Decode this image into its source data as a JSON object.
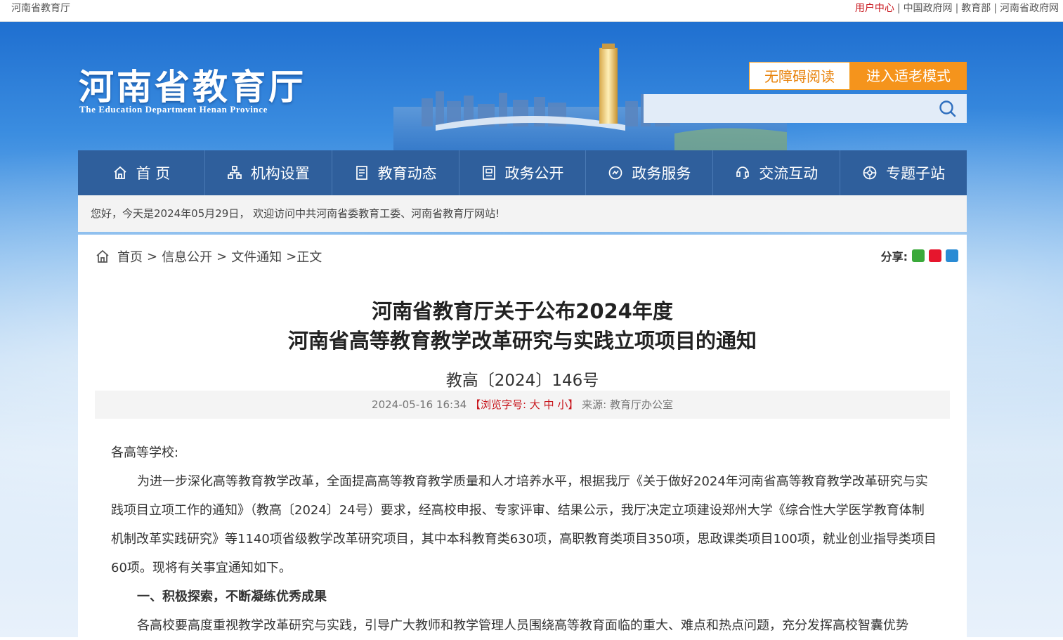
{
  "topbar": {
    "site_name": "河南省教育厅",
    "user_center": "用户中心",
    "links": [
      "中国政府网",
      "教育部",
      "河南省政府网"
    ]
  },
  "header": {
    "logo_cn": "河南省教育厅",
    "logo_en": "The Education Department Henan Province",
    "accessibility_label": "无障碍阅读",
    "elder_mode_label": "进入适老模式",
    "search_placeholder": ""
  },
  "nav": {
    "items": [
      {
        "label": "首 页",
        "icon": "home-icon"
      },
      {
        "label": "机构设置",
        "icon": "org-icon"
      },
      {
        "label": "教育动态",
        "icon": "news-icon"
      },
      {
        "label": "政务公开",
        "icon": "public-icon"
      },
      {
        "label": "政务服务",
        "icon": "service-icon"
      },
      {
        "label": "交流互动",
        "icon": "interact-icon"
      },
      {
        "label": "专题子站",
        "icon": "topic-icon"
      }
    ]
  },
  "welcome": "您好，今天是2024年05月29日， 欢迎访问中共河南省委教育工委、河南省教育厅网站!",
  "breadcrumb": {
    "items": [
      "首页",
      "信息公开",
      "文件通知"
    ],
    "current": "正文",
    "separator": ">"
  },
  "share": {
    "label": "分享:",
    "icons": [
      "wechat-icon",
      "weibo-icon",
      "qq-icon"
    ]
  },
  "article": {
    "title_line1": "河南省教育厅关于公布2024年度",
    "title_line2": "河南省高等教育教学改革研究与实践立项项目的通知",
    "doc_no": "教高〔2024〕146号",
    "date": "2024-05-16 16:34",
    "font_size_label": "【浏览字号: 大 中 小】",
    "source": "来源: 教育厅办公室",
    "salutation": "各高等学校:",
    "para1": "为进一步深化高等教育教学改革，全面提高高等教育教学质量和人才培养水平，根据我厅《关于做好2024年河南省高等教育教学改革研究与实践项目立项工作的通知》（教高〔2024〕24号）要求，经高校申报、专家评审、结果公示，我厅决定立项建设郑州大学《综合性大学医学教育体制机制改革实践研究》等1140项省级教学改革研究项目，其中本科教育类630项，高职教育类项目350项，思政课类项目100项，就业创业指导类项目60项。现将有关事宜通知如下。",
    "heading1": "一、积极探索，不断凝练优秀成果",
    "para2": "各高校要高度重视教学改革研究与实践，引导广大教师和教学管理人员围绕高等教育面临的重大、难点和热点问题，充分发挥高校智囊优势"
  },
  "colors": {
    "nav_bg": "#2f5f9c",
    "accent_red": "#c8161d",
    "orange": "#f5941c"
  }
}
